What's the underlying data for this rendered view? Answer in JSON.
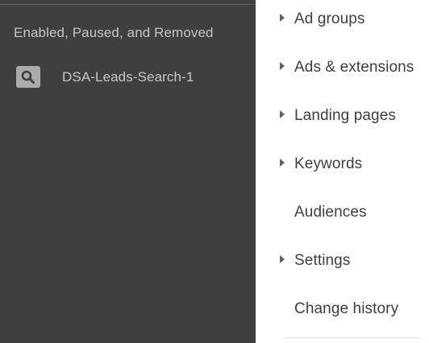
{
  "filter": {
    "label": "Enabled, Paused, and Removed"
  },
  "campaign": {
    "name": "DSA-Leads-Search-1",
    "icon": "search-icon"
  },
  "nav": {
    "items": [
      {
        "label": "Ad groups",
        "expandable": true
      },
      {
        "label": "Ads & extensions",
        "expandable": true
      },
      {
        "label": "Landing pages",
        "expandable": true
      },
      {
        "label": "Keywords",
        "expandable": true
      },
      {
        "label": "Audiences",
        "expandable": false
      },
      {
        "label": "Settings",
        "expandable": true
      },
      {
        "label": "Change history",
        "expandable": false
      }
    ]
  },
  "colors": {
    "left_bg": "#3c4043",
    "right_bg": "#ffffff",
    "nav_text": "#3c4043",
    "left_text": "#c4c7c5"
  }
}
